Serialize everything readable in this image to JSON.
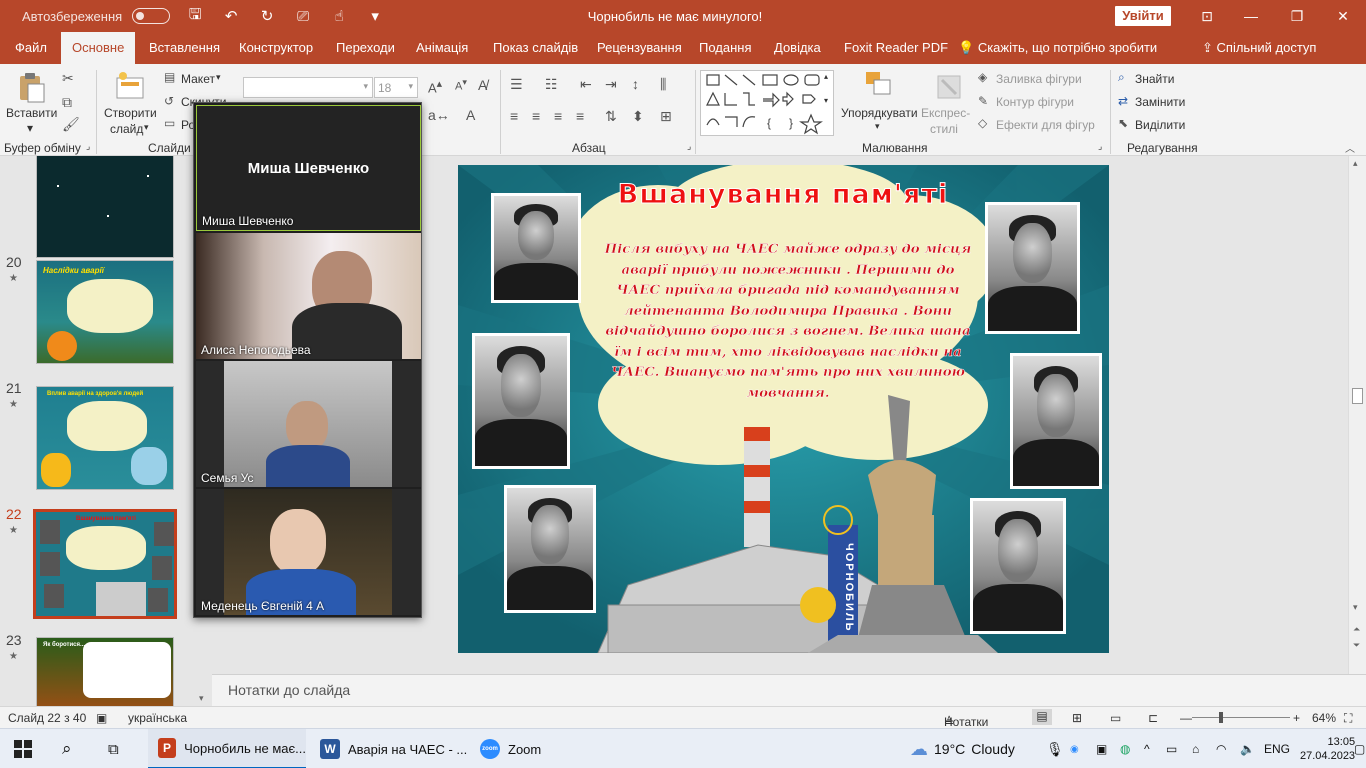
{
  "titlebar": {
    "autosave_label": "Автозбереження",
    "doc_title": "Чорнобиль не має минулого!",
    "signin_label": "Увійти"
  },
  "tabs": [
    "Файл",
    "Основне",
    "Вставлення",
    "Конструктор",
    "Переходи",
    "Анімація",
    "Показ слайдів",
    "Рецензування",
    "Подання",
    "Довідка",
    "Foxit Reader PDF"
  ],
  "active_tab": "Основне",
  "tellme": "Скажіть, що потрібно зробити",
  "share": "Спільний доступ",
  "ribbon": {
    "paste": "Вставити",
    "clipboard_group": "Буфер обміну",
    "new_slide_1": "Створити",
    "new_slide_2": "слайд",
    "layout": "Макет",
    "reset": "Скинути",
    "section": "Ро",
    "slides_group": "Слайди",
    "font_size": "18",
    "paragraph_group": "Абзац",
    "arrange": "Упорядкувати",
    "quick_styles_1": "Експрес-",
    "quick_styles_2": "стилі",
    "shape_fill": "Заливка фігури",
    "shape_outline": "Контур фігури",
    "shape_effects": "Ефекти для фігур",
    "drawing_group": "Малювання",
    "find": "Знайти",
    "replace": "Замінити",
    "select": "Виділити",
    "editing_group": "Редагування"
  },
  "thumbnails": [
    {
      "num": "20",
      "title": "Наслідки аварії",
      "star": "★"
    },
    {
      "num": "21",
      "title": "Вплив аварії на здоров'я людей",
      "star": "★"
    },
    {
      "num": "22",
      "title": "Вшанування пам'яті",
      "star": "★"
    },
    {
      "num": "23",
      "title": "Як боротися...",
      "star": "★"
    }
  ],
  "zoom": {
    "participants": [
      {
        "big": "Миша Шевченко",
        "name": "Миша Шевченко"
      },
      {
        "name": "Алиса Непогодьева"
      },
      {
        "name": "Семья Ус"
      },
      {
        "name": "Меденець Євгеній 4 А"
      }
    ]
  },
  "slide": {
    "title": "Вшанування пам'яті",
    "body": "Після вибуху на ЧАЕС майже одразу до місця аварії прибули пожежники . Першими до ЧАЕС приїхала бригада під командуванням лейтенанта Володимира Правика .  Вони відчайдушно боролися з вогнем. Велика шана їм і всім тим, хто ліквідовував  наслідки на ЧАЕС. Вшануємо пам'ять про них хвилиною мовчання.",
    "monument_label": "ЧОРНОБИЛЬ"
  },
  "notes_placeholder": "Нотатки до слайда",
  "status": {
    "slide_info": "Слайд 22 з 40",
    "language": "українська",
    "notes_label": "Нотатки",
    "zoom_level": "64%",
    "zoom_fraction": 0.64
  },
  "taskbar": {
    "apps": [
      "Чорнобиль не має...",
      "Аварія на ЧАЕС - ...",
      "Zoom"
    ],
    "weather_temp": "19°C",
    "weather_desc": "Cloudy",
    "lang": "ENG",
    "time": "13:05",
    "date": "27.04.2023"
  },
  "colors": {
    "accent": "#b7472a",
    "slide_title": "#e11111",
    "slide_bg": "#1f7a8a",
    "zoom_active_border": "#9bc93b"
  }
}
